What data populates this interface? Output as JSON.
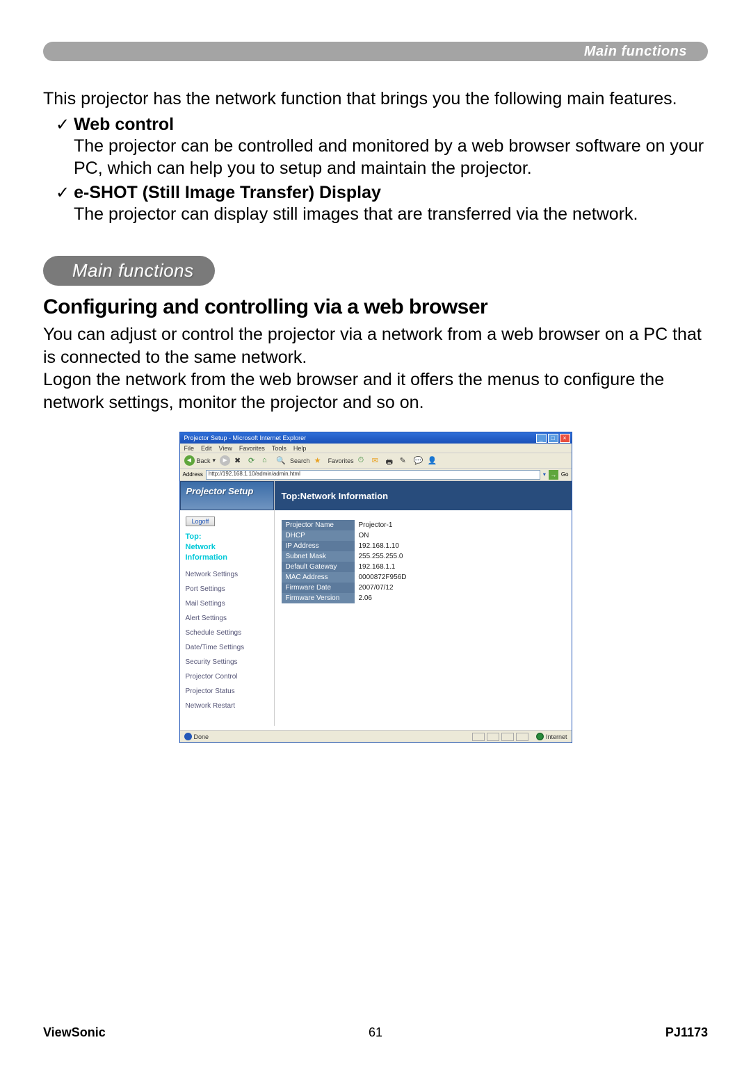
{
  "header_bar": "Main functions",
  "intro": "This projector has the network function that brings you the following main features.",
  "features": [
    {
      "title": "Web control",
      "desc": "The projector can be controlled and monitored by a web browser software on your PC, which can help you to setup and maintain the projector."
    },
    {
      "title": "e-SHOT (Still Image Transfer) Display",
      "desc": "The projector can display still images that are transferred via the network."
    }
  ],
  "section_pill": "Main functions",
  "section_heading": "Configuring and controlling via a web browser",
  "section_body_1": "You can adjust or control the projector via a network from a web browser on a PC that is connected to the same network.",
  "section_body_2": "Logon the network from the web browser and it offers the menus to configure the network settings, monitor the projector and so on.",
  "screenshot": {
    "title": "Projector Setup - Microsoft Internet Explorer",
    "menubar": [
      "File",
      "Edit",
      "View",
      "Favorites",
      "Tools",
      "Help"
    ],
    "toolbar": {
      "back": "Back",
      "search": "Search",
      "favorites": "Favorites"
    },
    "addressbar": {
      "label": "Address",
      "value": "http://192.168.1.10/admin/admin.html",
      "go": "Go"
    },
    "sidebar": {
      "logo": "Projector Setup",
      "logoff": "Logoff",
      "highlight_top": "Top:",
      "highlight_lines": [
        "Network",
        "Information"
      ],
      "items": [
        "Network Settings",
        "Port Settings",
        "Mail Settings",
        "Alert Settings",
        "Schedule Settings",
        "Date/Time Settings",
        "Security Settings",
        "Projector Control",
        "Projector Status",
        "Network Restart"
      ]
    },
    "main": {
      "header": "Top:Network Information",
      "rows": [
        {
          "label": "Projector Name",
          "value": "Projector-1"
        },
        {
          "label": "DHCP",
          "value": "ON"
        },
        {
          "label": "IP Address",
          "value": "192.168.1.10"
        },
        {
          "label": "Subnet Mask",
          "value": "255.255.255.0"
        },
        {
          "label": "Default Gateway",
          "value": "192.168.1.1"
        },
        {
          "label": "MAC Address",
          "value": "0000872F956D"
        },
        {
          "label": "Firmware Date",
          "value": "2007/07/12"
        },
        {
          "label": "Firmware Version",
          "value": "2.06"
        }
      ]
    },
    "statusbar": {
      "done": "Done",
      "zone": "Internet"
    }
  },
  "footer": {
    "left": "ViewSonic",
    "center": "61",
    "right": "PJ1173"
  }
}
